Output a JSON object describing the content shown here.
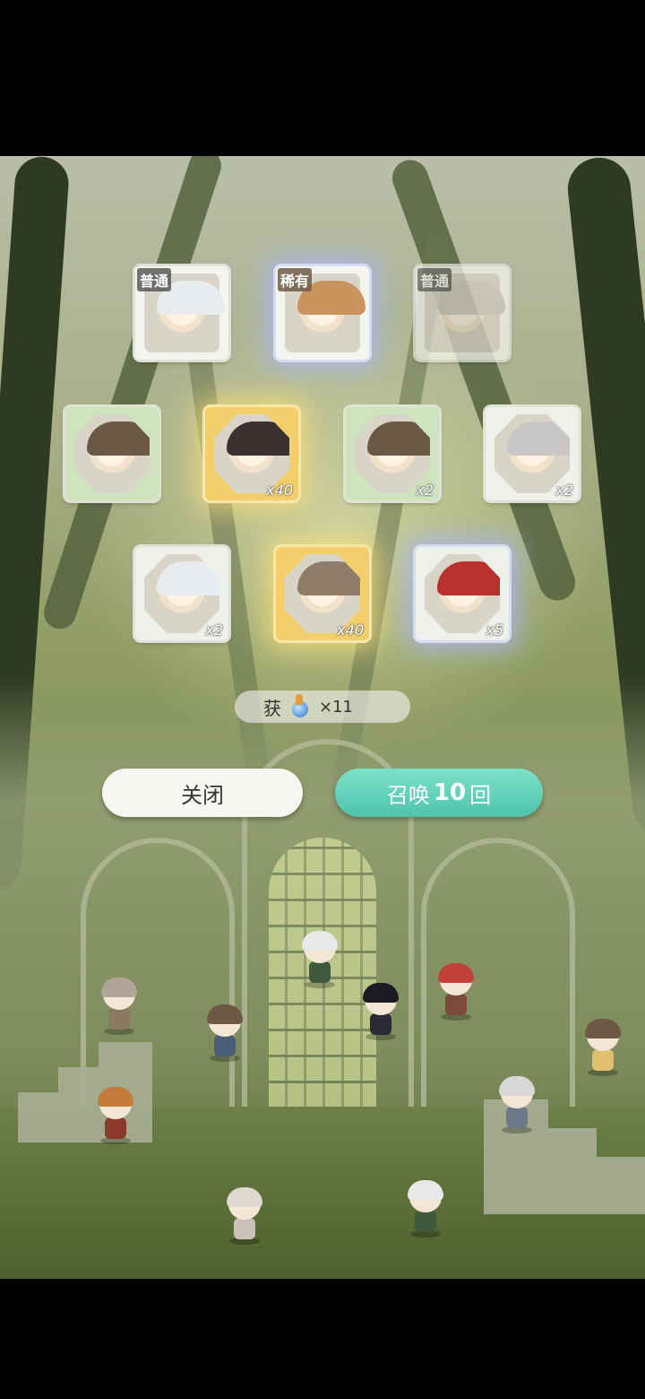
{
  "results": [
    {
      "tag": "普通",
      "count": "",
      "style": "normal",
      "hair": "#e9ecef"
    },
    {
      "tag": "稀有",
      "count": "",
      "style": "rare",
      "hair": "#c9935e"
    },
    {
      "tag": "普通",
      "count": "",
      "style": "faded",
      "hair": "#cfcac2"
    },
    {
      "tag": "",
      "count": "",
      "style": "shard",
      "hair": "#6b5845"
    },
    {
      "tag": "",
      "count": "x40",
      "style": "gold",
      "hair": "#3b3130"
    },
    {
      "tag": "",
      "count": "x2",
      "style": "shard",
      "hair": "#6b5845"
    },
    {
      "tag": "",
      "count": "x2",
      "style": "normal",
      "hair": "#c9c7c5"
    },
    {
      "tag": "",
      "count": "x2",
      "style": "normal",
      "hair": "#e9ecef"
    },
    {
      "tag": "",
      "count": "x40",
      "style": "gold",
      "hair": "#8d7d6a"
    },
    {
      "tag": "",
      "count": "x5",
      "style": "rare",
      "hair": "#b8312f"
    }
  ],
  "reward": {
    "label": "获",
    "count": "×11"
  },
  "buttons": {
    "close": "关闭",
    "summon_pre": "召唤",
    "summon_num": "10",
    "summon_post": "回"
  },
  "chibis": [
    {
      "name": "elf-boy",
      "hair": "#e6e8ea",
      "body": "#3f5a3a"
    },
    {
      "name": "grey-hair-girl",
      "hair": "#b0a598",
      "body": "#8a7a62"
    },
    {
      "name": "goggle-girl",
      "hair": "#6d5845",
      "body": "#4a5e78"
    },
    {
      "name": "witch",
      "hair": "#1c1a22",
      "body": "#2a2a36"
    },
    {
      "name": "red-hood",
      "hair": "#c2403a",
      "body": "#7a4a3a"
    },
    {
      "name": "goggle-girl-right",
      "hair": "#6d5845",
      "body": "#e0c070"
    },
    {
      "name": "bonnet-girl",
      "hair": "#c47a3a",
      "body": "#8a3a2a"
    },
    {
      "name": "silver-hair-right",
      "hair": "#d8d8d8",
      "body": "#6a7a8a"
    },
    {
      "name": "silver-hair-left",
      "hair": "#dedad2",
      "body": "#c8c2b8"
    },
    {
      "name": "elf-boy-bottom",
      "hair": "#e6e8ea",
      "body": "#3f5a3a"
    }
  ]
}
